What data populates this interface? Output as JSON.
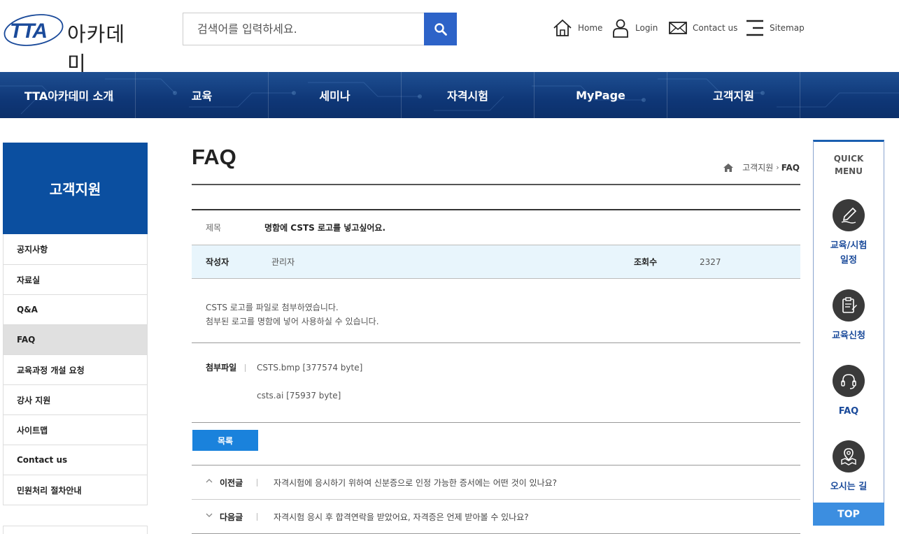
{
  "header": {
    "logo_tta": "TTA",
    "logo_academy": "아카데미",
    "search_placeholder": "검색어를 입력하세요.",
    "util": [
      {
        "label": "Home",
        "icon": "home-icon"
      },
      {
        "label": "Login",
        "icon": "user-icon"
      },
      {
        "label": "Contact us",
        "icon": "mail-icon"
      },
      {
        "label": "Sitemap",
        "icon": "menu-icon"
      }
    ]
  },
  "gnb": [
    "TTA아카데미 소개",
    "교육",
    "세미나",
    "자격시험",
    "MyPage",
    "고객지원"
  ],
  "lnb": {
    "title": "고객지원",
    "items": [
      "공지사항",
      "자료실",
      "Q&A",
      "FAQ",
      "교육과정 개설 요청",
      "강사 지원",
      "사이트맵",
      "Contact us",
      "민원처리 절차안내"
    ],
    "active_index": 3
  },
  "page": {
    "title": "FAQ",
    "breadcrumb": [
      "고객지원",
      "FAQ"
    ]
  },
  "post": {
    "subject_label": "제목",
    "subject": "명함에 CSTS 로고를 넣고싶어요.",
    "writer_label": "작성자",
    "writer": "관리자",
    "views_label": "조회수",
    "views": "2327",
    "body_lines": [
      "CSTS 로고를 파일로 첨부하였습니다.",
      "첨부된 로고를 명함에 넣어 사용하실 수 있습니다."
    ],
    "attach_label": "첨부파일",
    "files": [
      "CSTS.bmp [377574 byte]",
      "csts.ai [75937 byte]"
    ]
  },
  "list_button": "목록",
  "nav": {
    "prev_label": "이전글",
    "prev_title": "자격시험에 응시하기 위하여 신분증으로 인정 가능한 증서에는 어떤 것이 있나요?",
    "next_label": "다음글",
    "next_title": "자격시험 응시 후 합격연락을 받았어요, 자격증은 언제 받아볼 수 있나요?"
  },
  "quick": {
    "title_line1": "QUICK",
    "title_line2": "MENU",
    "items": [
      {
        "line1": "교육/시험",
        "line2": "일정",
        "icon": "pen-icon"
      },
      {
        "line1": "교육신청",
        "line2": "",
        "icon": "clipboard-icon"
      },
      {
        "line1": "FAQ",
        "line2": "",
        "icon": "headset-icon"
      },
      {
        "line1": "오시는 길",
        "line2": "",
        "icon": "map-pin-icon"
      }
    ],
    "top": "TOP"
  },
  "colors": {
    "brand_blue": "#0b4fa0",
    "search_button": "#2d63c8",
    "list_button": "#1a82dc",
    "writer_row_bg": "#e8f5fc"
  }
}
